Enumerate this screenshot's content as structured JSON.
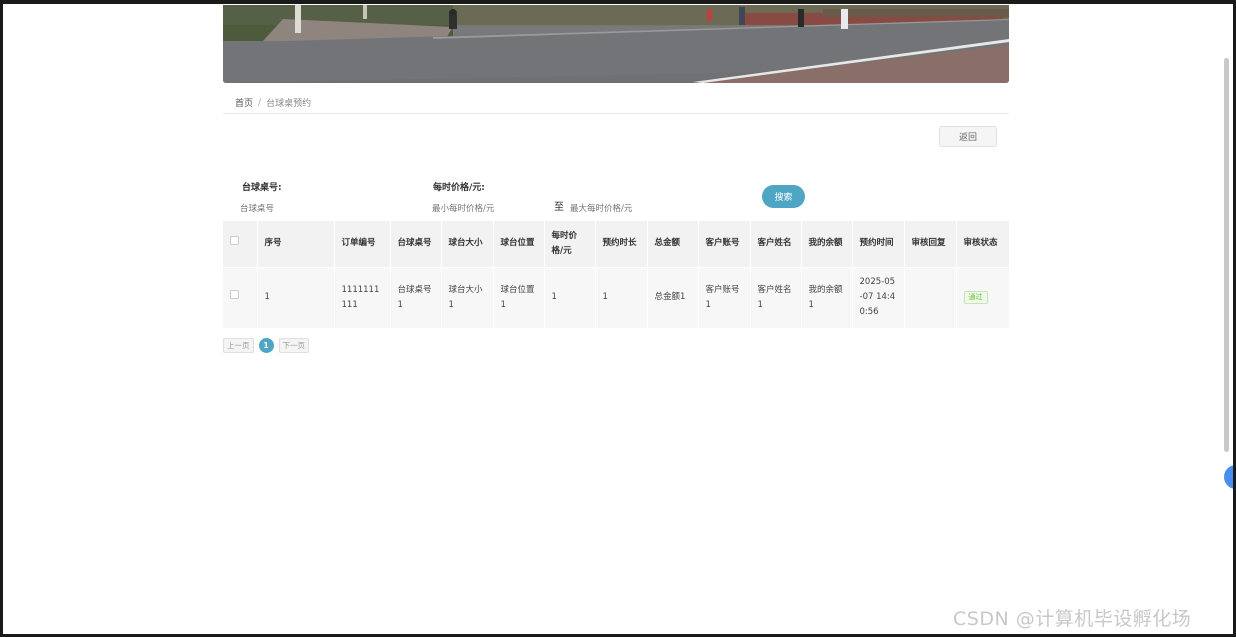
{
  "breadcrumb": {
    "home": "首页",
    "separator": "/",
    "current": "台球桌预约"
  },
  "back_button": "返回",
  "search": {
    "table_no_label": "台球桌号:",
    "table_no_placeholder": "台球桌号",
    "price_label": "每时价格/元:",
    "price_min_placeholder": "最小每时价格/元",
    "range_separator": "至",
    "price_max_placeholder": "最大每时价格/元",
    "search_button": "搜索"
  },
  "table": {
    "headers": [
      "序号",
      "订单编号",
      "台球桌号",
      "球台大小",
      "球台位置",
      "每时价格/元",
      "预约时长",
      "总金额",
      "客户账号",
      "客户姓名",
      "我的余额",
      "预约时间",
      "审核回复",
      "审核状态"
    ],
    "rows": [
      [
        "1",
        "1111111111",
        "台球桌号1",
        "球台大小1",
        "球台位置1",
        "1",
        "1",
        "总金额1",
        "客户账号1",
        "客户姓名1",
        "我的余额1",
        "2025-05-07 14:40:56",
        "",
        "通过"
      ]
    ]
  },
  "pagination": {
    "prev": "上一页",
    "current_page": "1",
    "next": "下一页"
  },
  "watermark": "CSDN @计算机毕设孵化场",
  "colors": {
    "accent": "#4ea6c4",
    "status_pass": "#67c23a"
  }
}
